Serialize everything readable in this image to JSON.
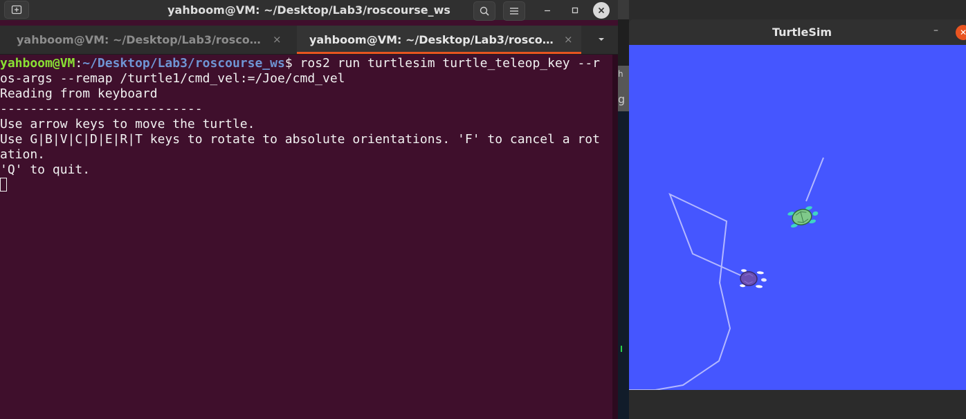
{
  "terminal": {
    "title": "yahboom@VM: ~/Desktop/Lab3/roscourse_ws",
    "tabs": [
      {
        "label": "yahboom@VM: ~/Desktop/Lab3/rosco…",
        "active": false
      },
      {
        "label": "yahboom@VM: ~/Desktop/Lab3/rosco…",
        "active": true
      }
    ],
    "tab_close_glyph": "×",
    "prompt_user": "yahboom@VM",
    "prompt_sep": ":",
    "prompt_path": "~/Desktop/Lab3/roscourse_ws",
    "prompt_dollar": "$ ",
    "command_line1": "ros2 run turtlesim turtle_teleop_key --r",
    "command_line2": "os-args --remap /turtle1/cmd_vel:=/Joe/cmd_vel",
    "output": [
      "Reading from keyboard",
      "---------------------------",
      "Use arrow keys to move the turtle.",
      "Use G|B|V|C|D|E|R|T keys to rotate to absolute orientations. 'F' to cancel a rot",
      "ation.",
      "'Q' to quit."
    ],
    "icons": {
      "new_tab": "new-tab-icon",
      "search": "search-icon",
      "menu": "hamburger-menu-icon",
      "minimize": "minimize-icon",
      "maximize": "maximize-icon",
      "close": "close-icon",
      "tab_dropdown": "chevron-down-icon"
    }
  },
  "background": {
    "text_fragment_1": "h",
    "text_fragment_2": "g"
  },
  "turtlesim": {
    "title": "TurtleSim",
    "minimize_glyph": "–",
    "close_glyph": "✕",
    "background_color": "#4556ff",
    "pen_color": "#b3b8ff",
    "turtles": [
      {
        "name": "turtle-green",
        "color": "#7fc98a"
      },
      {
        "name": "turtle-purple",
        "color": "#6a4fb5"
      }
    ]
  }
}
